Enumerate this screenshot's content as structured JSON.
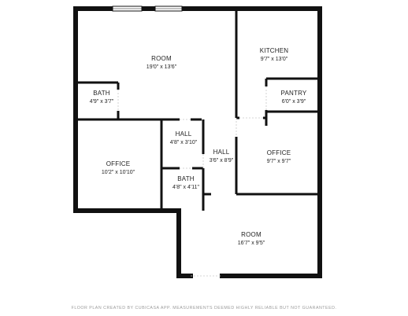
{
  "rooms": [
    {
      "id": "room-main",
      "label": "ROOM",
      "dim": "19'0\" x 13'6\""
    },
    {
      "id": "kitchen",
      "label": "KITCHEN",
      "dim": "9'7\" x 13'0\""
    },
    {
      "id": "bath-upper",
      "label": "BATH",
      "dim": "4'9\" x 3'7\""
    },
    {
      "id": "pantry",
      "label": "PANTRY",
      "dim": "6'0\" x 3'9\""
    },
    {
      "id": "hall-upper",
      "label": "HALL",
      "dim": "4'8\" x 3'10\""
    },
    {
      "id": "hall-center",
      "label": "HALL",
      "dim": "3'6\" x 8'9\""
    },
    {
      "id": "office-left",
      "label": "OFFICE",
      "dim": "10'2\" x 10'10\""
    },
    {
      "id": "office-right",
      "label": "OFFICE",
      "dim": "9'7\" x 9'7\""
    },
    {
      "id": "bath-lower",
      "label": "BATH",
      "dim": "4'8\" x 4'11\""
    },
    {
      "id": "room-lower",
      "label": "ROOM",
      "dim": "16'7\" x 9'5\""
    }
  ],
  "footer": "FLOOR PLAN CREATED BY CUBICASA APP. MEASUREMENTS DEEMED HIGHLY RELIABLE BUT NOT GUARANTEED.",
  "colors": {
    "wall": "#111111",
    "partition": "#111111",
    "door": "#c8c8c8",
    "footer": "#9a9a9a"
  }
}
